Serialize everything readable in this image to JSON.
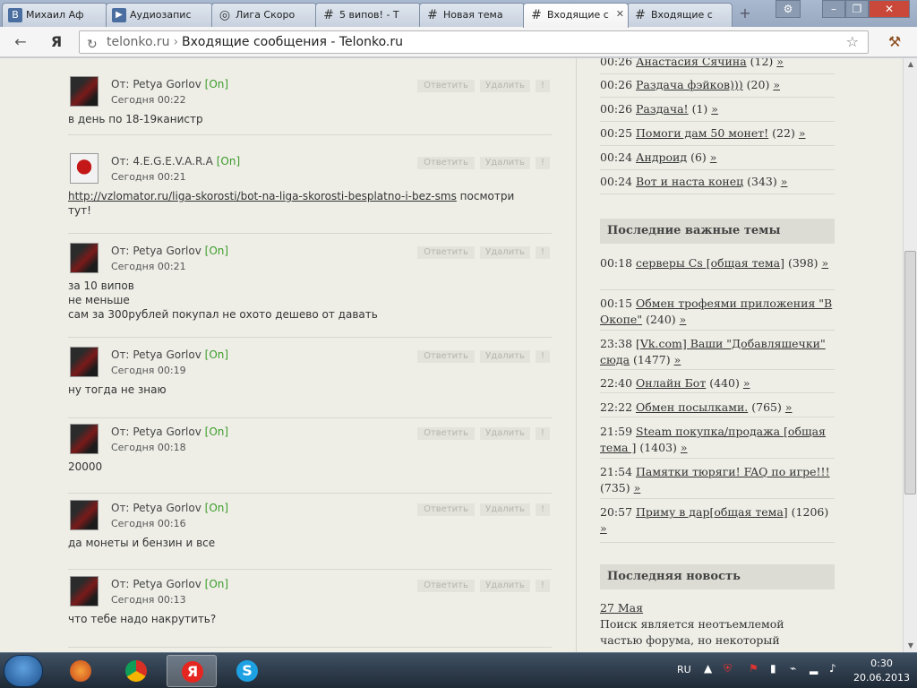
{
  "tabs": [
    {
      "label": "Михаил Аф",
      "icon": "В"
    },
    {
      "label": "Аудиозапис",
      "icon": "▶"
    },
    {
      "label": "Лига Скоро",
      "icon": "◎"
    },
    {
      "label": "5 випов! - Т",
      "icon": "#"
    },
    {
      "label": "Новая тема",
      "icon": "#"
    },
    {
      "label": "Входящие с",
      "icon": "#"
    },
    {
      "label": "Входящие с",
      "icon": "#"
    }
  ],
  "omnibox": {
    "host": "telonko.ru",
    "separator": "›",
    "title": "Входящие сообщения - Telonko.ru"
  },
  "toolbar": {
    "back": "←",
    "yandex": "Я"
  },
  "actions": {
    "reply": "Ответить",
    "delete": "Удалить",
    "mark": "!"
  },
  "from_prefix": "От:",
  "messages": [
    {
      "sender": "Petya Gorlov",
      "status": "[On]",
      "time": "Сегодня 00:22",
      "lines": [
        "в день по 18-19канистр"
      ]
    },
    {
      "sender": "4.E.G.E.V.A.R.A",
      "status": "[On]",
      "time": "Сегодня 00:21",
      "link": "http://vzlomator.ru/liga-skorosti/bot-na-liga-skorosti-besplatno-i-bez-sms",
      "link_tail": " посмотри",
      "lines": [
        "тут!"
      ]
    },
    {
      "sender": "Petya Gorlov",
      "status": "[On]",
      "time": "Сегодня 00:21",
      "lines": [
        "за 10 випов",
        "не меньше",
        "сам за 300рублей покупал не охото дешево от давать"
      ]
    },
    {
      "sender": "Petya Gorlov",
      "status": "[On]",
      "time": "Сегодня 00:19",
      "lines": [
        "ну тогда не знаю"
      ]
    },
    {
      "sender": "Petya Gorlov",
      "status": "[On]",
      "time": "Сегодня 00:18",
      "lines": [
        "20000"
      ]
    },
    {
      "sender": "Petya Gorlov",
      "status": "[On]",
      "time": "Сегодня 00:16",
      "lines": [
        "да монеты и бензин и все"
      ]
    },
    {
      "sender": "Petya Gorlov",
      "status": "[On]",
      "time": "Сегодня 00:13",
      "lines": [
        "что тебе надо накрутить?"
      ]
    }
  ],
  "recent_topics": [
    {
      "time": "00:26",
      "title": "Анастасия Сячина",
      "count": "(12)",
      "more": "»"
    },
    {
      "time": "00:26",
      "title": "Раздача фэйков)))",
      "count": "(20)",
      "more": "»"
    },
    {
      "time": "00:26",
      "title": "Раздача!",
      "count": "(1)",
      "more": "»"
    },
    {
      "time": "00:25",
      "title": "Помоги дам 50 монет!",
      "count": "(22)",
      "more": "»"
    },
    {
      "time": "00:24",
      "title": "Андроид",
      "count": "(6)",
      "more": "»"
    },
    {
      "time": "00:24",
      "title": "Вот и наста конец",
      "count": "(343)",
      "more": "»"
    }
  ],
  "important_header": "Последние важные темы",
  "important_topics": [
    {
      "time": "00:18",
      "title": "серверы Cs [общая тема]",
      "count": "(398)",
      "more": "»"
    },
    {
      "time": "00:15",
      "title": "Обмен трофеями приложения \"В Окопе\"",
      "count": "(240)",
      "more": "»"
    },
    {
      "time": "23:38",
      "title": "[Vk.com] Ваши \"Добавляшечки\" сюда",
      "count": "(1477)",
      "more": "»"
    },
    {
      "time": "22:40",
      "title": "Онлайн Бот",
      "count": "(440)",
      "more": "»"
    },
    {
      "time": "22:22",
      "title": "Обмен посылками.",
      "count": "(765)",
      "more": "»"
    },
    {
      "time": "21:59",
      "title": "Steam покупка/продажа [общая тема ]",
      "count": "(1403)",
      "more": "»"
    },
    {
      "time": "21:54",
      "title": "Памятки тюряги! FAQ по игре!!!",
      "count": "(735)",
      "more": "»"
    },
    {
      "time": "20:57",
      "title": "Приму в дар[общая тема]",
      "count": "(1206)",
      "more": "»"
    }
  ],
  "news_header": "Последняя новость",
  "news": {
    "date": "27 Мая",
    "lines": [
      "Поиск является неотъемлемой",
      "частью форума, но некоторый"
    ]
  },
  "taskbar": {
    "lang": "RU",
    "clock_time": "0:30",
    "clock_date": "20.06.2013"
  },
  "colors": {
    "online": "#3c9b2a",
    "page_bg": "#eeeee7",
    "header_bg": "#dcdcd4"
  }
}
